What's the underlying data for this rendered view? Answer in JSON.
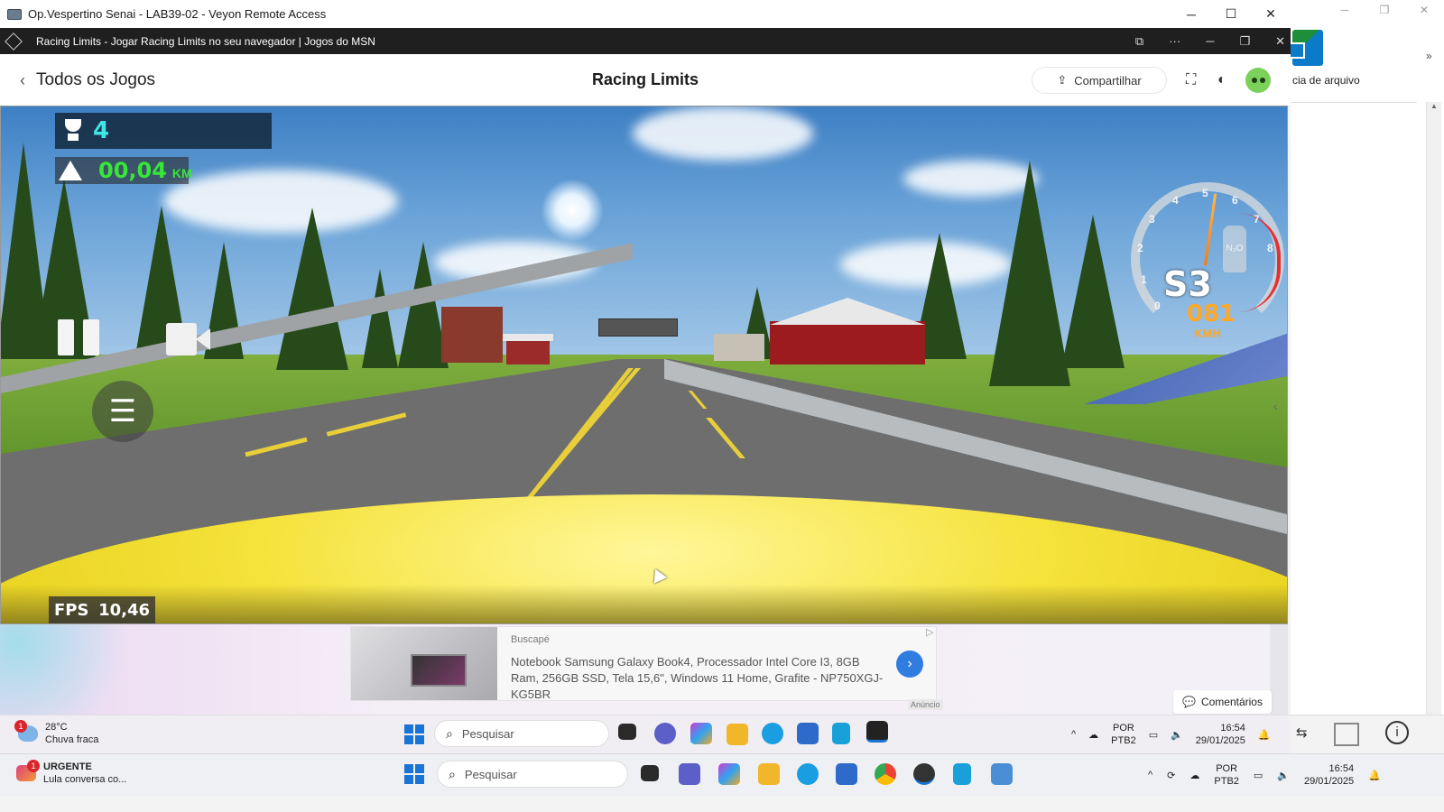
{
  "veyon": {
    "title": "Op.Vespertino Senai - LAB39-02 - Veyon Remote Access",
    "minimize": "─",
    "maximize": "☐",
    "close": "✕"
  },
  "background_window": {
    "file_label": "cia de arquivo",
    "chevron": "»",
    "controls": {
      "minimize": "─",
      "restore": "❐",
      "close": "✕"
    }
  },
  "browser": {
    "tab_title": "Racing Limits - Jogar Racing Limits no seu navegador | Jogos do MSN",
    "controls": {
      "cast": "⧉",
      "more": "···",
      "minimize": "─",
      "restore": "❐",
      "close": "✕"
    }
  },
  "header": {
    "back_label": "Todos os Jogos",
    "back_chevron": "‹",
    "title": "Racing Limits",
    "share_label": "Compartilhar",
    "share_icon": "⇪",
    "fullscreen_icon": "⛶",
    "theme_icon": "◐"
  },
  "hud": {
    "trophies": "4",
    "distance": "00,04",
    "distance_unit": "KM",
    "fps_label": "FPS",
    "fps_value": "10,46",
    "gear": "S3",
    "speed": "081",
    "speed_unit": "KMH",
    "nitro": "N₂O",
    "lights_glyph": "☰",
    "gauge_ticks": [
      "0",
      "1",
      "2",
      "3",
      "4",
      "5",
      "6",
      "7",
      "8"
    ],
    "side_tab_chevron": "‹"
  },
  "ad": {
    "brand": "Buscapé",
    "text": "Notebook Samsung Galaxy Book4, Processador Intel Core I3, 8GB Ram, 256GB SSD, Tela 15,6\", Windows 11 Home, Grafite - NP750XGJ-KG5BR",
    "go": "›",
    "flag": "▷",
    "label": "Anúncio"
  },
  "comments": {
    "label": "Comentários",
    "icon": "💬"
  },
  "taskbar_inner": {
    "weather_temp": "28°C",
    "weather_desc": "Chuva fraca",
    "weather_badge": "1",
    "search_placeholder": "Pesquisar",
    "lang_top": "POR",
    "lang_bottom": "PTB2",
    "time": "16:54",
    "date": "29/01/2025",
    "tray_chevron": "^"
  },
  "taskbar_outer": {
    "notif_title": "URGENTE",
    "notif_text": "Lula conversa co...",
    "notif_badge": "1",
    "search_placeholder": "Pesquisar",
    "lang_top": "POR",
    "lang_bottom": "PTB2",
    "time": "16:54",
    "date": "29/01/2025",
    "tray_chevron": "^"
  },
  "colors": {
    "accent": "#2f7de1",
    "trophy_text": "#3ee6e6",
    "distance_text": "#37e637",
    "speed_text": "#ffa726",
    "hood": "#f5e23a"
  }
}
